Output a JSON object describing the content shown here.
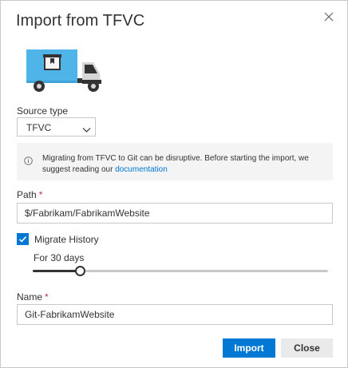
{
  "dialog": {
    "title": "Import from TFVC",
    "close_icon": "close-icon",
    "illustration_icon": "moving-truck-icon"
  },
  "source_type": {
    "label": "Source type",
    "value": "TFVC",
    "icon": "chevron-down-icon"
  },
  "info": {
    "icon": "info-icon",
    "message": "Migrating from TFVC to Git can be disruptive. Before starting the import, we suggest reading our",
    "link_text": "documentation"
  },
  "path": {
    "label": "Path",
    "required_marker": "*",
    "value": "$/Fabrikam/FabrikamWebsite"
  },
  "history": {
    "checkbox_label": "Migrate History",
    "checked": true,
    "check_icon": "checkmark-icon",
    "duration_label": "For 30 days",
    "slider_fraction": 0.16
  },
  "name": {
    "label": "Name",
    "required_marker": "*",
    "value": "Git-FabrikamWebsite"
  },
  "buttons": {
    "import_label": "Import",
    "close_label": "Close"
  },
  "colors": {
    "accent": "#0078d4",
    "required": "#c4314b",
    "info_background": "#f4f4f4",
    "truck_box": "#4fb4e8"
  }
}
